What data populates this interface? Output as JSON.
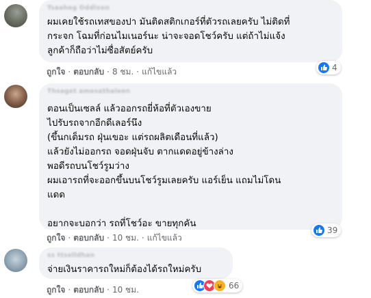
{
  "comments": [
    {
      "text": "ผมเคยใช้รถเทสของปา มันติดสติกเกอร์ที่ตัวรถเลยครับ ไม่ติดที่\nกระจก โฉมที่ก่อนไมเนอร์นะ น่าจะจอดโชว์ครับ แต่ถ้าไม่แจ้ง\nลูกค้าก็ถือว่าไม่ซื่อสัตย์ครับ",
      "author": "Tsaaheg Oddlxon",
      "like_label": "ถูกใจ",
      "reply_label": "ตอบกลับ",
      "time": "8 ชม.",
      "edited": "แก้ไขแล้ว",
      "reaction_count": "4"
    },
    {
      "text": "ตอนเป็นเซลล์ แล้วออกรถยี่ห้อที่ตัวเองขาย\nไปรับรถจากอีกดีเลอร์นึง\n(ขึ้นกเต็มรถ ฝุ่นเขอะ แต่รถผลิตเดือนที่แล้ว)\nแล้วยังไม่ออกรถ จอดฝุ่นจับ ตากแดดอยู่ข้างล่าง\nพอดีรถบนโชว์รูมว่าง\nผมเอารถที่จะออกขึ้นบนโชว์รูมเลยครับ แอร์เย็น แถมไม่โดน\nแดด\n\nอยากจะบอกว่า รถที่โชว์อะ ขายทุกคัน",
      "author": "Thsaget amesathaleen",
      "like_label": "ถูกใจ",
      "reply_label": "ตอบกลับ",
      "time": "10 ชม.",
      "edited": "แก้ไขแล้ว",
      "reaction_count": "39"
    },
    {
      "text": "จ่ายเงินราคารถใหม่ก็ต้องได้รถใหม่ครับ",
      "author": "ss ttselldhan",
      "like_label": "ถูกใจ",
      "reply_label": "ตอบกลับ",
      "time": "10 ชม.",
      "reaction_count": "66"
    }
  ],
  "colors": {
    "bubble": "#f0f2f5",
    "meta_text": "#65676b",
    "like_blue": "#1877f2",
    "heart_red": "#f33e58",
    "haha_yellow": "#f7b125"
  },
  "icons": [
    "avatar",
    "like-icon",
    "heart-icon",
    "haha-icon"
  ]
}
